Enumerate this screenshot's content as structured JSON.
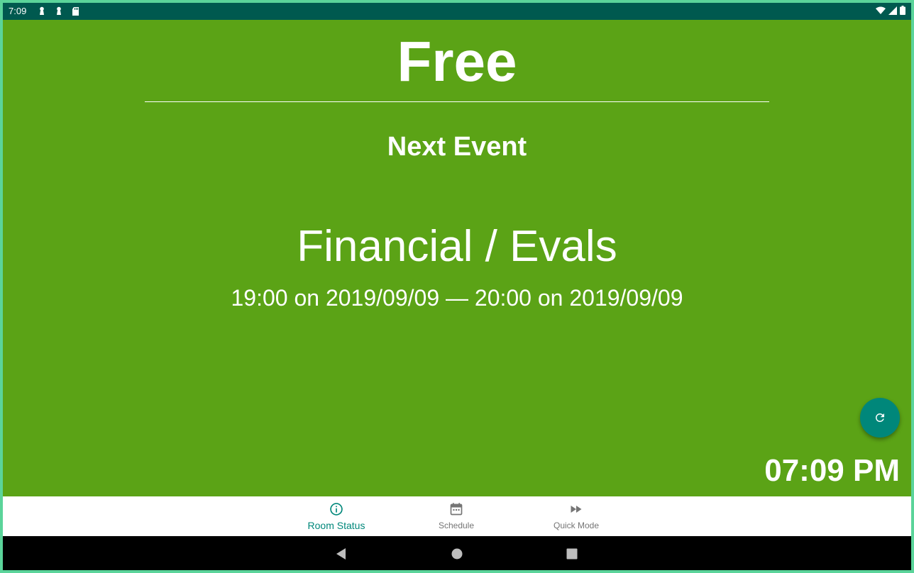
{
  "status_bar": {
    "time": "7:09",
    "notification_icons": [
      "pawn-icon",
      "pawn-icon",
      "sd-card-icon"
    ],
    "right_icons": [
      "wifi-icon",
      "signal-icon",
      "battery-icon"
    ]
  },
  "room": {
    "status": "Free",
    "next_label": "Next Event",
    "event_title": "Financial / Evals",
    "event_time": "19:00 on 2019/09/09 — 20:00 on 2019/09/09",
    "clock": "07:09 PM"
  },
  "refresh_button": {
    "icon": "refresh-icon"
  },
  "bottom_nav": {
    "items": [
      {
        "label": "Room Status",
        "icon": "info-icon",
        "active": true
      },
      {
        "label": "Schedule",
        "icon": "calendar-icon",
        "active": false
      },
      {
        "label": "Quick Mode",
        "icon": "fast-forward-icon",
        "active": false
      }
    ]
  },
  "system_nav": {
    "buttons": [
      "back-icon",
      "home-icon",
      "recents-icon"
    ]
  },
  "colors": {
    "background": "#5ba316",
    "status_bar": "#00594f",
    "accent": "#00877a",
    "nav_inactive": "#757575"
  }
}
